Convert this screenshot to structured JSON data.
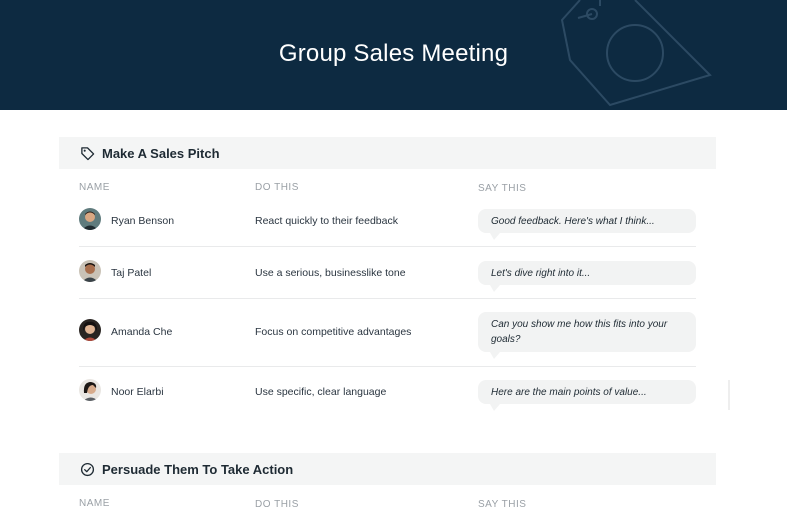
{
  "header": {
    "title": "Group Sales Meeting"
  },
  "sections": [
    {
      "title": "Make A Sales Pitch",
      "icon": "tag-icon",
      "columns": [
        "NAME",
        "DO THIS",
        "SAY THIS"
      ],
      "rows": [
        {
          "name": "Ryan Benson",
          "do_this": "React quickly to their feedback",
          "say_this": "Good feedback. Here's what I think..."
        },
        {
          "name": "Taj Patel",
          "do_this": "Use a serious, businesslike tone",
          "say_this": "Let's dive right into it..."
        },
        {
          "name": "Amanda Che",
          "do_this": "Focus on competitive advantages",
          "say_this": "Can you show me how this fits into your goals?"
        },
        {
          "name": "Noor Elarbi",
          "do_this": "Use specific, clear language",
          "say_this": "Here are the main points of value..."
        }
      ]
    },
    {
      "title": "Persuade Them To Take Action",
      "icon": "check-circle-icon",
      "columns": [
        "NAME",
        "DO THIS",
        "SAY THIS"
      ],
      "rows": []
    }
  ],
  "colors": {
    "header_bg": "#0d2a41",
    "section_bg": "#f4f5f5",
    "bubble_bg": "#f2f3f3"
  }
}
